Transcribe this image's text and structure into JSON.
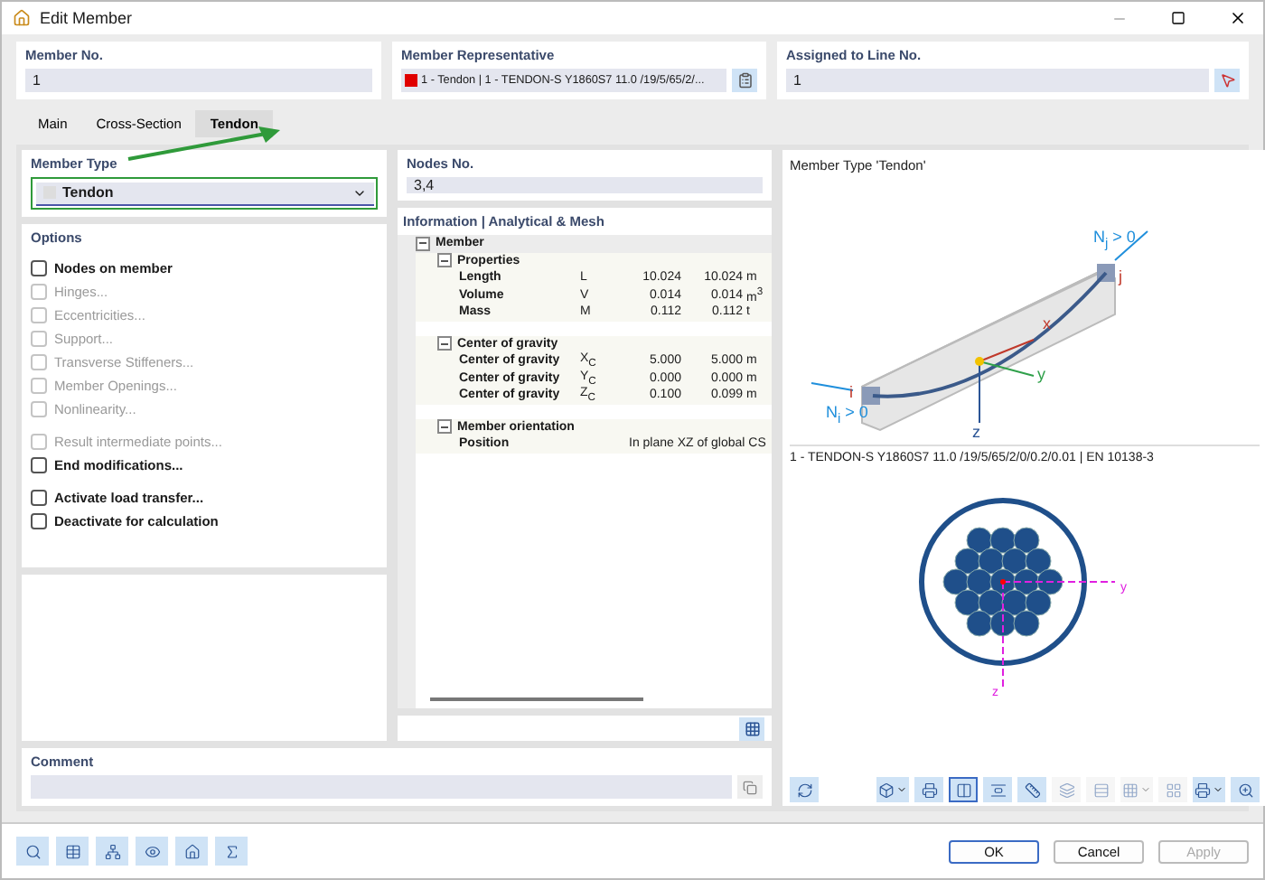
{
  "window": {
    "title": "Edit Member"
  },
  "member_no": {
    "label": "Member No.",
    "value": "1"
  },
  "member_representative": {
    "label": "Member Representative",
    "value": "1 - Tendon | 1 - TENDON-S Y1860S7 11.0 /19/5/65/2/...",
    "color": "#e00000"
  },
  "assigned_line": {
    "label": "Assigned to Line No.",
    "value": "1"
  },
  "tabs": [
    {
      "label": "Main",
      "selected": false
    },
    {
      "label": "Cross-Section",
      "selected": false
    },
    {
      "label": "Tendon",
      "selected": true
    }
  ],
  "member_type": {
    "label": "Member Type",
    "value": "Tendon",
    "highlighted": true
  },
  "options": {
    "title": "Options",
    "groups": [
      [
        {
          "label": "Nodes on member",
          "checked": false,
          "disabled": false
        },
        {
          "label": "Hinges...",
          "checked": false,
          "disabled": true
        },
        {
          "label": "Eccentricities...",
          "checked": false,
          "disabled": true
        },
        {
          "label": "Support...",
          "checked": false,
          "disabled": true
        },
        {
          "label": "Transverse Stiffeners...",
          "checked": false,
          "disabled": true
        },
        {
          "label": "Member Openings...",
          "checked": false,
          "disabled": true
        },
        {
          "label": "Nonlinearity...",
          "checked": false,
          "disabled": true
        }
      ],
      [
        {
          "label": "Result intermediate points...",
          "checked": false,
          "disabled": true
        },
        {
          "label": "End modifications...",
          "checked": false,
          "disabled": false
        }
      ],
      [
        {
          "label": "Activate load transfer...",
          "checked": false,
          "disabled": false
        },
        {
          "label": "Deactivate for calculation",
          "checked": false,
          "disabled": false
        }
      ]
    ]
  },
  "nodes_no": {
    "label": "Nodes No.",
    "value": "3,4"
  },
  "information": {
    "title": "Information | Analytical & Mesh",
    "tree": [
      {
        "label": "Member",
        "expanded": true,
        "children": [
          {
            "label": "Properties",
            "expanded": true,
            "children": [
              {
                "label": "Length",
                "symbol": "L",
                "value_1": "10.024",
                "value_2": "10.024",
                "unit": "m"
              },
              {
                "label": "Volume",
                "symbol": "V",
                "value_1": "0.014",
                "value_2": "0.014",
                "unit": "m$^{3}$"
              },
              {
                "label": "Mass",
                "symbol": "M",
                "value_1": "0.112",
                "value_2": "0.112",
                "unit": "t"
              }
            ]
          },
          {
            "label": "Center of gravity",
            "expanded": true,
            "children": [
              {
                "label": "Center of gravity",
                "symbol": "X$_{C}$",
                "value_1": "5.000",
                "value_2": "5.000",
                "unit": "m"
              },
              {
                "label": "Center of gravity",
                "symbol": "Y$_{C}$",
                "value_1": "0.000",
                "value_2": "0.000",
                "unit": "m"
              },
              {
                "label": "Center of gravity",
                "symbol": "Z$_{C}$",
                "value_1": "0.100",
                "value_2": "0.099",
                "unit": "m"
              }
            ]
          },
          {
            "label": "Member orientation",
            "expanded": true,
            "children": [
              {
                "label": "Position",
                "value_1": "In plane XZ of global CS"
              }
            ]
          }
        ]
      }
    ]
  },
  "comment": {
    "label": "Comment"
  },
  "preview": {
    "title": "Member Type 'Tendon'",
    "labels": {
      "nj": "N$_{j}$ > 0",
      "ni": "N$_{i}$ > 0",
      "x": "x",
      "y": "y",
      "z": "z",
      "i": "i",
      "j": "j"
    },
    "section_title": "1 - TENDON-S Y1860S7 11.0 /19/5/65/2/0/0.2/0.01 | EN 10138-3",
    "section_labels": {
      "y": "y",
      "z": "z"
    }
  },
  "view_toolbar": [
    {
      "selected": false,
      "disabled": false,
      "menu": true
    },
    {
      "selected": false,
      "disabled": false,
      "menu": false
    },
    {
      "selected": true,
      "disabled": false,
      "menu": false
    },
    {
      "selected": false,
      "disabled": false,
      "menu": false
    },
    {
      "selected": false,
      "disabled": false,
      "menu": false
    },
    {
      "selected": false,
      "disabled": true,
      "menu": false
    },
    {
      "selected": false,
      "disabled": true,
      "menu": false
    },
    {
      "selected": false,
      "disabled": true,
      "menu": true
    },
    {
      "selected": false,
      "disabled": true,
      "menu": false
    },
    {
      "selected": false,
      "disabled": false,
      "menu": true
    },
    {
      "selected": false,
      "disabled": false,
      "menu": false
    }
  ],
  "buttons": [
    {
      "label": "OK",
      "default": true,
      "disabled": false
    },
    {
      "label": "Cancel",
      "default": false,
      "disabled": false
    },
    {
      "label": "Apply",
      "default": false,
      "disabled": true
    }
  ]
}
